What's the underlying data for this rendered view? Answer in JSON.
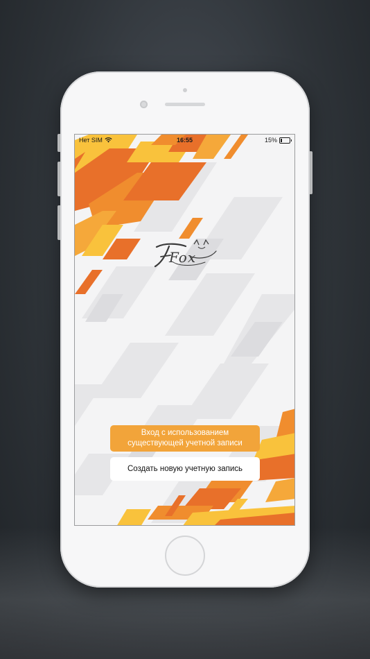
{
  "status_bar": {
    "carrier": "Нет SIM",
    "time": "16:55",
    "battery": "15%"
  },
  "logo": {
    "text": "Fox"
  },
  "actions": {
    "login_label": "Вход с использованием существующей учетной записи",
    "create_label": "Создать новую учетную запись"
  },
  "colors": {
    "accent": "#f2a43a",
    "orange_dark": "#e8702a",
    "yellow": "#f9c23c"
  }
}
